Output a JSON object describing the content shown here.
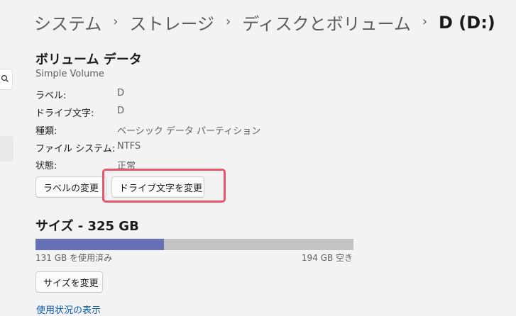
{
  "breadcrumb": {
    "items": [
      "システム",
      "ストレージ",
      "ディスクとボリューム"
    ],
    "current": "D (D:)",
    "separator": "›"
  },
  "volume_data": {
    "title": "ボリューム データ",
    "subtitle": "Simple Volume",
    "properties": [
      {
        "label": "ラベル:",
        "value": "D"
      },
      {
        "label": "ドライブ文字:",
        "value": "D"
      },
      {
        "label": "種類:",
        "value": "ベーシック データ パーティション"
      },
      {
        "label": "ファイル システム:",
        "value": "NTFS"
      },
      {
        "label": "状態:",
        "value": "正常"
      }
    ],
    "change_label_button": "ラベルの変更",
    "change_drive_letter_button": "ドライブ文字を変更"
  },
  "size": {
    "title": "サイズ - 325 GB",
    "used_text": "131 GB を使用済み",
    "free_text": "194 GB 空き",
    "used_fraction": 0.403,
    "change_size_button": "サイズを変更",
    "usage_link": "使用状況の表示"
  },
  "colors": {
    "used_bar": "#6670b6",
    "free_bar": "#c3c3c3",
    "highlight": "#e8566b",
    "link": "#0b5cad"
  }
}
